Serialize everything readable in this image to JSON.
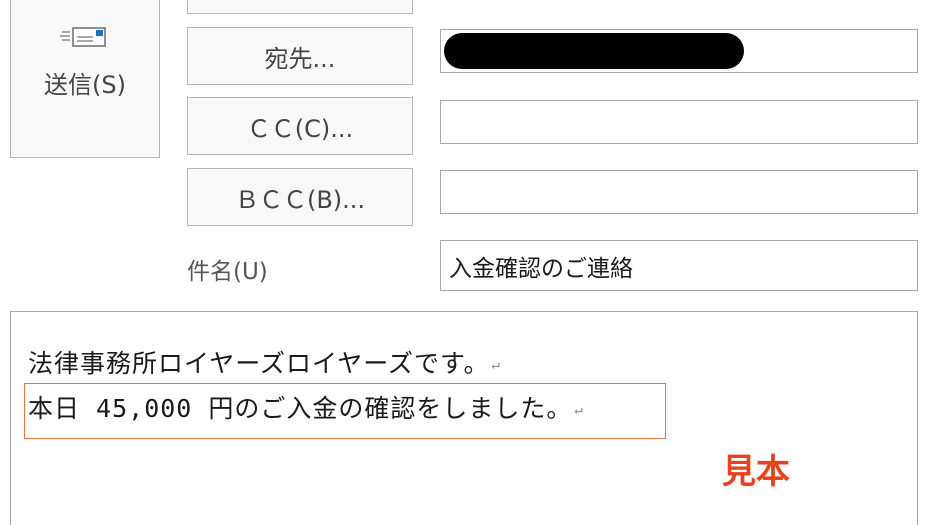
{
  "toolbar": {
    "send_label": "送信(S)",
    "send_icon": "send-envelope-icon"
  },
  "address": {
    "to_label": "宛先...",
    "cc_label": "ＣＣ(C)...",
    "bcc_label": "ＢＣＣ(B)...",
    "to_value": "",
    "cc_value": "",
    "bcc_value": ""
  },
  "subject": {
    "label": "件名(U)",
    "value": "入金確認のご連絡"
  },
  "body": {
    "line1": "法律事務所ロイヤーズロイヤーズです。",
    "line2": "本日 45,000 円のご入金の確認をしました。",
    "paragraph_mark": "↵"
  },
  "watermark": {
    "text": "見本"
  },
  "colors": {
    "highlight_border": "#e8734a",
    "watermark": "#e8411e",
    "accent_icon": "#1f6fc0"
  }
}
